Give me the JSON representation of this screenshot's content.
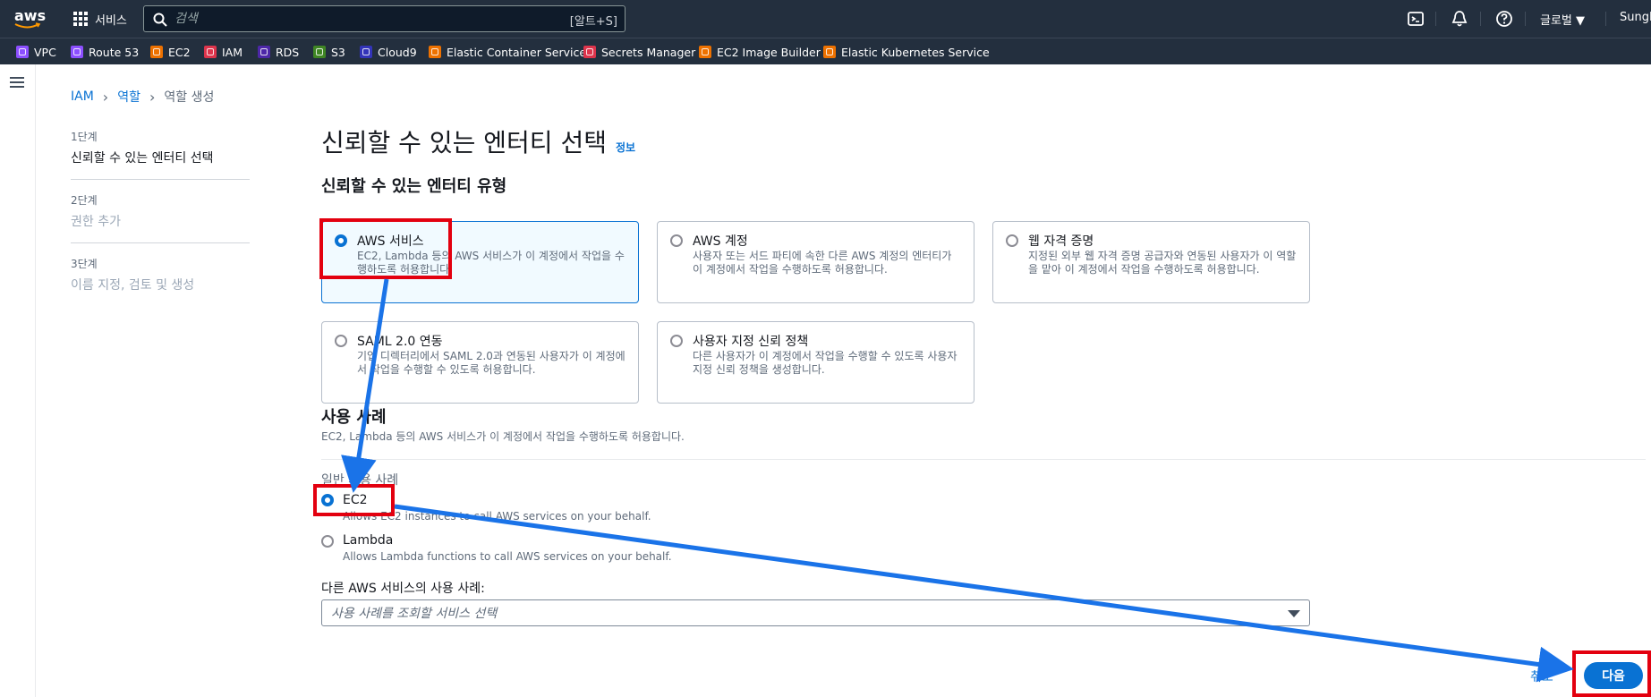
{
  "topnav": {
    "logo": "aws",
    "services_label": "서비스",
    "search_placeholder": "검색",
    "search_shortcut": "[알트+S]",
    "region": "글로벌 ▼",
    "user": "SungD"
  },
  "favorites": [
    {
      "label": "VPC",
      "color": "#8c4fff"
    },
    {
      "label": "Route 53",
      "color": "#8c4fff"
    },
    {
      "label": "EC2",
      "color": "#ed7100"
    },
    {
      "label": "IAM",
      "color": "#dd344c"
    },
    {
      "label": "RDS",
      "color": "#4d27a8"
    },
    {
      "label": "S3",
      "color": "#3f8624"
    },
    {
      "label": "Cloud9",
      "color": "#3334b9"
    },
    {
      "label": "Elastic Container Service",
      "color": "#ed7100"
    },
    {
      "label": "Secrets Manager",
      "color": "#dd344c"
    },
    {
      "label": "EC2 Image Builder",
      "color": "#ed7100"
    },
    {
      "label": "Elastic Kubernetes Service",
      "color": "#ed7100"
    }
  ],
  "breadcrumb": {
    "root": "IAM",
    "parent": "역할",
    "current": "역할 생성"
  },
  "steps": [
    {
      "num": "1단계",
      "title": "신뢰할 수 있는 엔터티 선택"
    },
    {
      "num": "2단계",
      "title": "권한 추가"
    },
    {
      "num": "3단계",
      "title": "이름 지정, 검토 및 생성"
    }
  ],
  "page": {
    "title": "신뢰할 수 있는 엔터티 선택",
    "info": "정보"
  },
  "entity_section": {
    "heading": "신뢰할 수 있는 엔터티 유형"
  },
  "tiles": [
    {
      "title": "AWS 서비스",
      "desc": "EC2, Lambda 등의 AWS 서비스가 이 계정에서 작업을 수행하도록 허용합니다."
    },
    {
      "title": "AWS 계정",
      "desc": "사용자 또는 서드 파티에 속한 다른 AWS 계정의 엔터티가 이 계정에서 작업을 수행하도록 허용합니다."
    },
    {
      "title": "웹 자격 증명",
      "desc": "지정된 외부 웹 자격 증명 공급자와 연동된 사용자가 이 역할을 맡아 이 계정에서 작업을 수행하도록 허용합니다."
    },
    {
      "title": "SAML 2.0 연동",
      "desc": "기업 디렉터리에서 SAML 2.0과 연동된 사용자가 이 계정에서 작업을 수행할 수 있도록 허용합니다."
    },
    {
      "title": "사용자 지정 신뢰 정책",
      "desc": "다른 사용자가 이 계정에서 작업을 수행할 수 있도록 사용자 지정 신뢰 정책을 생성합니다."
    }
  ],
  "usecase": {
    "heading": "사용 사례",
    "desc": "EC2, Lambda 등의 AWS 서비스가 이 계정에서 작업을 수행하도록 허용합니다.",
    "common_heading": "일반 사용 사례",
    "options": [
      {
        "label": "EC2",
        "sub": "Allows EC2 instances to call AWS services on your behalf."
      },
      {
        "label": "Lambda",
        "sub": "Allows Lambda functions to call AWS services on your behalf."
      }
    ],
    "other_heading": "다른 AWS 서비스의 사용 사례:",
    "select_placeholder": "사용 사례를 조회할 서비스 선택"
  },
  "actions": {
    "cancel": "취소",
    "next": "다음"
  },
  "colors": {
    "accent": "#0972d3",
    "highlight": "#e3000f",
    "annotation_arrow": "#1a73e8",
    "nav": "#232f3e"
  }
}
